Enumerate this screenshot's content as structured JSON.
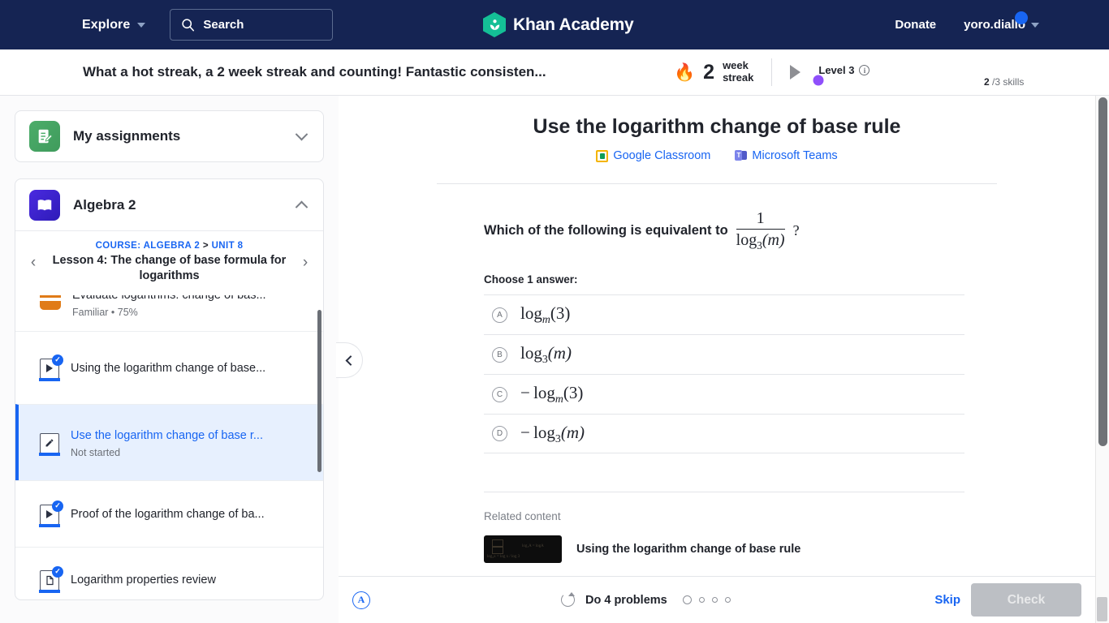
{
  "topnav": {
    "explore_label": "Explore",
    "search_placeholder": "Search",
    "brand": "Khan Academy",
    "donate_label": "Donate",
    "user_name": "yoro.diallo"
  },
  "streakbar": {
    "message": "What a hot streak, a 2 week streak and counting! Fantastic consisten...",
    "flame_icon": "🔥",
    "streak_count": "2",
    "streak_unit_line1": "week",
    "streak_unit_line2": "streak",
    "level_label": "Level 3",
    "level_progress_percent": 66,
    "skills_completed": "2",
    "skills_total": "/3 skills",
    "accent_purple": "#8f4ffb"
  },
  "sidebar": {
    "assignments": {
      "title": "My assignments",
      "expanded": false
    },
    "course": {
      "title": "Algebra 2",
      "expanded": true,
      "breadcrumb_course": "COURSE: ALGEBRA 2",
      "breadcrumb_sep": ">",
      "breadcrumb_unit": "UNIT 8",
      "lesson_title": "Lesson 4: The change of base formula for logarithms"
    },
    "items": [
      {
        "title": "Evaluate logarithms: change of bas...",
        "subtitle": "Familiar • 75%",
        "icon": "mastery-icon",
        "state": "default"
      },
      {
        "title": "Using the logarithm change of base...",
        "subtitle": "",
        "icon": "video-icon",
        "state": "completed"
      },
      {
        "title": "Use the logarithm change of base r...",
        "subtitle": "Not started",
        "icon": "exercise-icon",
        "state": "active"
      },
      {
        "title": "Proof of the logarithm change of ba...",
        "subtitle": "",
        "icon": "video-icon",
        "state": "completed"
      },
      {
        "title": "Logarithm properties review",
        "subtitle": "",
        "icon": "article-icon",
        "state": "completed"
      }
    ]
  },
  "main": {
    "exercise_title": "Use the logarithm change of base rule",
    "share_links": [
      {
        "label": "Google Classroom",
        "icon": "google-classroom-icon"
      },
      {
        "label": "Microsoft Teams",
        "icon": "microsoft-teams-icon"
      }
    ],
    "question": {
      "prompt": "Which of the following is equivalent to",
      "fraction_numerator": "1",
      "fraction_denominator_base": "log",
      "fraction_denominator_sub": "3",
      "fraction_denominator_arg": "(m)",
      "suffix": "?"
    },
    "choose_label": "Choose 1 answer:",
    "choices": [
      {
        "letter": "A",
        "base": "log",
        "sub": "m",
        "arg": "(3)",
        "negative": ""
      },
      {
        "letter": "B",
        "base": "log",
        "sub": "3",
        "arg": "(m)",
        "negative": ""
      },
      {
        "letter": "C",
        "base": "log",
        "sub": "m",
        "arg": "(3)",
        "negative": "− "
      },
      {
        "letter": "D",
        "base": "log",
        "sub": "3",
        "arg": "(m)",
        "negative": "− "
      }
    ],
    "related_label": "Related content",
    "related_item_title": "Using the logarithm change of base rule"
  },
  "bottombar": {
    "accessibility_icon": "A",
    "do_problems_label": "Do 4 problems",
    "dot_count": 4,
    "skip_label": "Skip",
    "check_label": "Check",
    "check_enabled": false
  }
}
